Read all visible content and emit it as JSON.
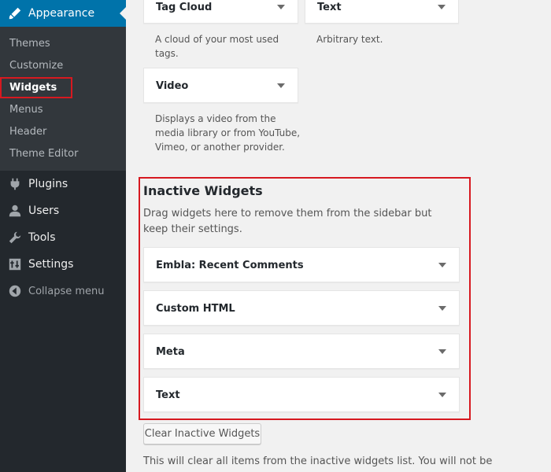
{
  "sidebar": {
    "active_menu": {
      "label": "Appearance",
      "icon": "paintbrush-icon"
    },
    "submenu": [
      {
        "label": "Themes"
      },
      {
        "label": "Customize"
      },
      {
        "label": "Widgets",
        "current": true
      },
      {
        "label": "Menus"
      },
      {
        "label": "Header"
      },
      {
        "label": "Theme Editor"
      }
    ],
    "menu": [
      {
        "label": "Plugins",
        "icon": "plug-icon"
      },
      {
        "label": "Users",
        "icon": "user-icon"
      },
      {
        "label": "Tools",
        "icon": "wrench-icon"
      },
      {
        "label": "Settings",
        "icon": "settings-icon"
      }
    ],
    "collapse": {
      "label": "Collapse menu",
      "icon": "collapse-icon"
    }
  },
  "widgets": {
    "tag_cloud": {
      "label": "Tag Cloud",
      "desc_1": "A cloud of your most used",
      "desc_2": "tags."
    },
    "text": {
      "label": "Text",
      "desc": "Arbitrary text."
    },
    "video": {
      "label": "Video",
      "desc_1": "Displays a video from the",
      "desc_2": "media library or from YouTube,",
      "desc_3": "Vimeo, or another provider."
    }
  },
  "inactive": {
    "title": "Inactive Widgets",
    "desc": "Drag widgets here to remove them from the sidebar but keep their settings.",
    "items": [
      {
        "label": "Embla: Recent Comments"
      },
      {
        "label": "Custom HTML"
      },
      {
        "label": "Meta"
      },
      {
        "label": "Text"
      }
    ]
  },
  "clear_button": "Clear Inactive Widgets",
  "bottom_text": "This will clear all items from the inactive widgets list. You will not be"
}
